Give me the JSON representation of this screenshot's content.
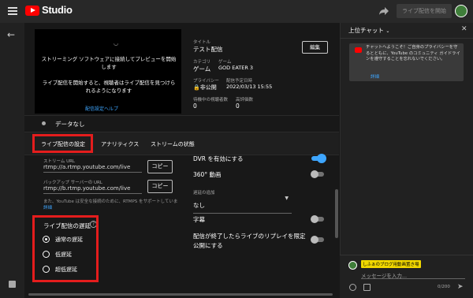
{
  "header": {
    "brand": "Studio",
    "go_live_button": "ライブ配信を開始"
  },
  "preview": {
    "message1": "ストリーミング ソフトウェアに接続してプレビューを開始します",
    "message2": "ライブ配信を開始すると、視聴者はライブ配信を見つけられるようになります",
    "help_link": "配信設定ヘルプ"
  },
  "details": {
    "title_label": "タイトル",
    "title_value": "テスト配信",
    "category_label": "カテゴリ",
    "category_value": "ゲーム",
    "game_label": "ゲーム",
    "game_value": "GOD EATER 3",
    "privacy_label": "プライバシー",
    "privacy_value": "非公開",
    "scheduled_label": "配信予定日時",
    "scheduled_value": "2022/03/13 15:55",
    "waiting_label": "待機中の視聴者数",
    "waiting_value": "0",
    "likes_label": "高評価数",
    "likes_value": "0",
    "edit_button": "編集"
  },
  "status": {
    "no_data": "データなし"
  },
  "tabs": [
    "ライブ配信の設定",
    "アナリティクス",
    "ストリームの状態"
  ],
  "stream": {
    "url_label": "ストリーム URL",
    "url_value": "rtmp://a.rtmp.youtube.com/live",
    "backup_label": "バックアップ サーバーの URL",
    "backup_value": "rtmp://b.rtmp.youtube.com/live",
    "copy_button": "コピー",
    "note": "また、YouTube は安全な接続のために、RTMPS をサポートしていま",
    "note_link": "詳細"
  },
  "latency": {
    "title": "ライブ配信の遅延",
    "options": [
      "通常の遅延",
      "低遅延",
      "超低遅延"
    ],
    "selected": 0
  },
  "settings": {
    "dvr_label": "DVR を有効にする",
    "dvr_on": true,
    "vr360_label": "360° 動画",
    "vr360_on": false,
    "delay_label": "遅延の追加",
    "delay_value": "なし",
    "captions_label": "字幕",
    "captions_on": false,
    "replay_label": "配信が終了したらライブのリプレイを限定公開にする",
    "replay_on": false
  },
  "chat": {
    "title": "上位チャット",
    "welcome": "チャットへようこそ！ご自身のプライバシーを守るとともに、YouTube のコミュニティ ガイドラインを遵守することを忘れないでください。",
    "welcome_link": "詳細",
    "user_name": "しふぁのブログ用動画置き場",
    "input_placeholder": "メッセージを入力...",
    "char_count": "0/200"
  }
}
